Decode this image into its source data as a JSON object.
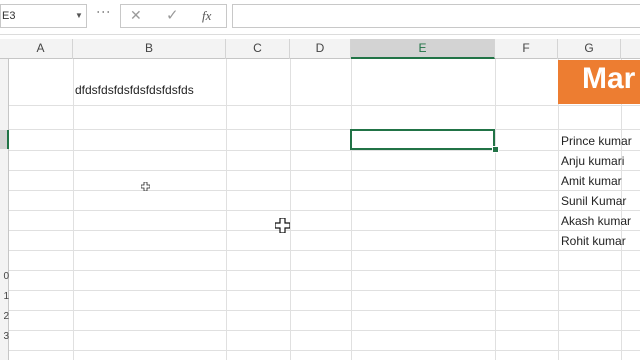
{
  "formula_bar": {
    "name_box": "E3",
    "name_box_arrow": "▼",
    "dots": "⋮",
    "cancel_icon": "✕",
    "confirm_icon": "✓",
    "fx_label": "fx",
    "formula": ""
  },
  "columns": [
    "A",
    "B",
    "C",
    "D",
    "E",
    "F",
    "G"
  ],
  "active_column": "E",
  "rows": [
    "",
    "",
    "",
    "",
    "",
    "",
    "",
    "",
    "",
    "0",
    "1",
    "2",
    "3"
  ],
  "cells": {
    "b1": "dfdsfdsfdsfdsfdsfdsfds",
    "g1": "Mar",
    "names": [
      "Prince kumar",
      "Anju kumari",
      "Amit kumar",
      "Sunil Kumar",
      "Akash kumar",
      "Rohit kumar"
    ]
  },
  "colors": {
    "accent": "#217346",
    "title_fill": "#ed7d31"
  }
}
